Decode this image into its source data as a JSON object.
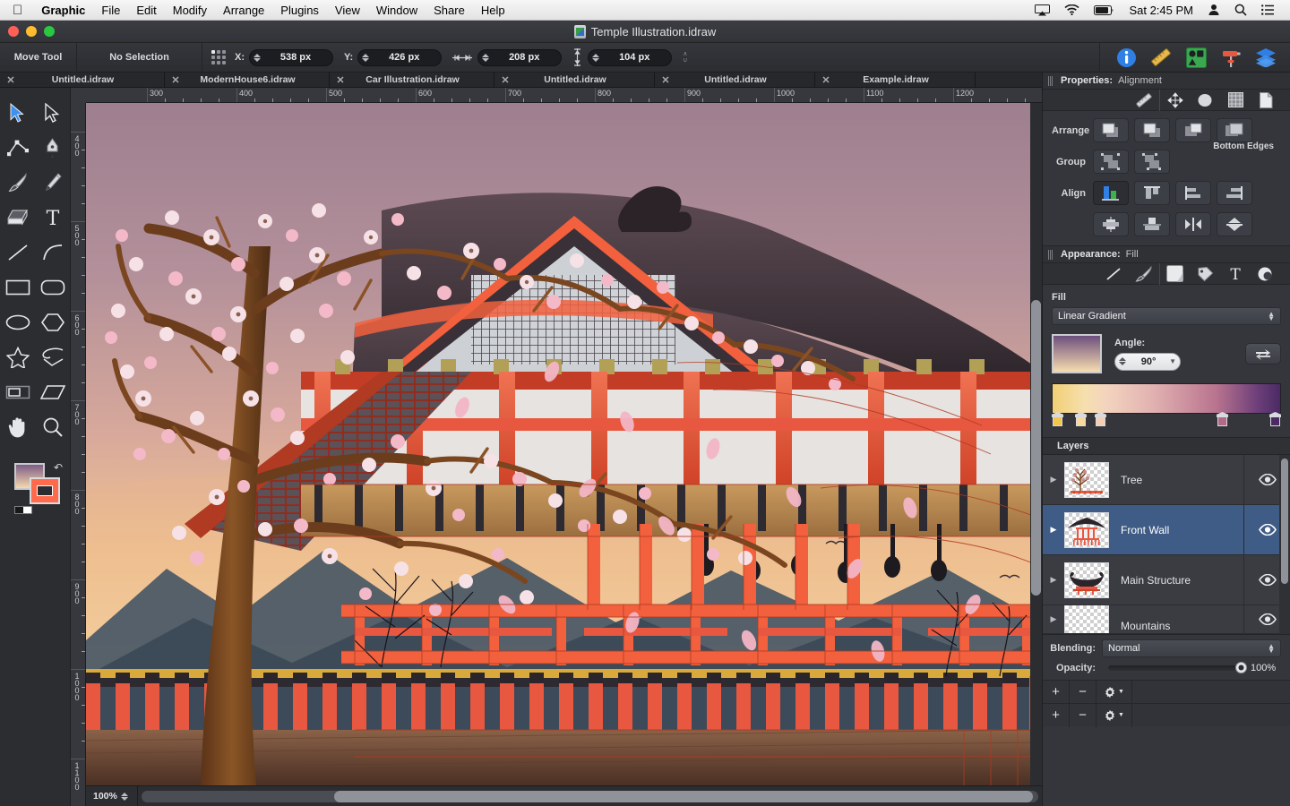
{
  "menubar": {
    "apple_icon": "apple-logo-icon",
    "items": [
      {
        "label": "Graphic",
        "bold": true
      },
      {
        "label": "File",
        "bold": false
      },
      {
        "label": "Edit",
        "bold": false
      },
      {
        "label": "Modify",
        "bold": false
      },
      {
        "label": "Arrange",
        "bold": false
      },
      {
        "label": "Plugins",
        "bold": false
      },
      {
        "label": "View",
        "bold": false
      },
      {
        "label": "Window",
        "bold": false
      },
      {
        "label": "Share",
        "bold": false
      },
      {
        "label": "Help",
        "bold": false
      }
    ],
    "status": {
      "airplay_icon": "airplay-icon",
      "wifi_icon": "wifi-icon",
      "battery_icon": "battery-icon",
      "clock": "Sat 2:45 PM",
      "user_icon": "user-account-icon",
      "search_icon": "spotlight-search-icon",
      "notifications_icon": "notification-center-icon"
    }
  },
  "window": {
    "title": "Temple Illustration.idraw",
    "close_label": "",
    "minimize_label": "",
    "zoom_label": ""
  },
  "toolbar": {
    "tool_name": "Move Tool",
    "selection_status": "No Selection",
    "anchor_icon": "anchor-grid-icon",
    "fields": [
      {
        "label": "X:",
        "value": "538 px",
        "name": "x-position-field"
      },
      {
        "label": "Y:",
        "value": "426 px",
        "name": "y-position-field"
      },
      {
        "label": "",
        "value": "208 px",
        "name": "width-field",
        "icon": "width-arrows-icon"
      },
      {
        "label": "",
        "value": "104 px",
        "name": "height-field",
        "icon": "height-arrows-icon"
      }
    ],
    "lock_icon": "link-lock-icon",
    "right_icons": [
      {
        "name": "info-icon",
        "label": "Info"
      },
      {
        "name": "ruler-icon",
        "label": "Measure"
      },
      {
        "name": "shapes-icon",
        "label": "Shapes"
      },
      {
        "name": "paint-roller-icon",
        "label": "Appearance"
      },
      {
        "name": "layers-icon",
        "label": "Layers"
      }
    ]
  },
  "tabs": {
    "close_glyph": "✕",
    "overflow_glyph": "»",
    "items": [
      {
        "label": "Untitled.idraw",
        "active": false
      },
      {
        "label": "ModernHouse6.idraw",
        "active": false
      },
      {
        "label": "Car Illustration.idraw",
        "active": false
      },
      {
        "label": "Untitled.idraw",
        "active": false
      },
      {
        "label": "Untitled.idraw",
        "active": false
      },
      {
        "label": "Example.idraw",
        "active": false
      }
    ]
  },
  "tools": [
    {
      "name": "move-tool",
      "selected": true
    },
    {
      "name": "direct-selection-tool",
      "selected": false
    },
    {
      "name": "node-tool",
      "selected": false
    },
    {
      "name": "pen-tool",
      "selected": false
    },
    {
      "name": "brush-tool",
      "selected": false
    },
    {
      "name": "pencil-tool",
      "selected": false
    },
    {
      "name": "eraser-tool",
      "selected": false
    },
    {
      "name": "text-tool",
      "selected": false
    },
    {
      "name": "line-tool",
      "selected": false
    },
    {
      "name": "arc-tool",
      "selected": false
    },
    {
      "name": "rectangle-tool",
      "selected": false
    },
    {
      "name": "rounded-rectangle-tool",
      "selected": false
    },
    {
      "name": "ellipse-tool",
      "selected": false
    },
    {
      "name": "polygon-tool",
      "selected": false
    },
    {
      "name": "star-tool",
      "selected": false
    },
    {
      "name": "spiral-tool",
      "selected": false
    },
    {
      "name": "image-tool",
      "selected": false
    },
    {
      "name": "shear-tool",
      "selected": false
    },
    {
      "name": "hand-tool",
      "selected": false
    },
    {
      "name": "zoom-tool",
      "selected": false
    }
  ],
  "rulers": {
    "horizontal_ticks": [
      "300",
      "400",
      "500",
      "600",
      "700",
      "800",
      "900",
      "1000",
      "1100",
      "1200"
    ],
    "vertical_ticks": [
      "400",
      "500",
      "600",
      "700",
      "800",
      "900",
      "1000",
      "1100"
    ],
    "unit": "px"
  },
  "canvas": {
    "zoom_level": "100%",
    "artwork_title": "Japanese temple at sunset with cherry blossom tree"
  },
  "properties": {
    "header_label": "Properties:",
    "header_value": "Alignment",
    "tabs": [
      {
        "name": "measure-tab-icon",
        "selected": false
      },
      {
        "name": "alignment-tab-icon",
        "selected": true
      },
      {
        "name": "shadow-tab-icon",
        "selected": false
      },
      {
        "name": "grid-tab-icon",
        "selected": false
      },
      {
        "name": "document-tab-icon",
        "selected": false
      }
    ],
    "arrange": {
      "label": "Arrange",
      "buttons": [
        {
          "name": "bring-to-front-button"
        },
        {
          "name": "bring-forward-button"
        },
        {
          "name": "send-backward-button"
        },
        {
          "name": "send-to-back-button"
        }
      ]
    },
    "group": {
      "label": "Group",
      "buttons": [
        {
          "name": "group-button"
        },
        {
          "name": "ungroup-button"
        }
      ]
    },
    "align": {
      "label": "Align",
      "tooltip": "Bottom Edges",
      "row1": [
        {
          "name": "align-to-selection-button",
          "selected": true
        },
        {
          "name": "align-top-edges-button",
          "selected": false
        },
        {
          "name": "align-left-edges-button",
          "selected": false
        },
        {
          "name": "align-bottom-edges-button",
          "selected": false
        }
      ],
      "row2": [
        {
          "name": "align-horizontal-centers-button",
          "selected": false
        },
        {
          "name": "align-vertical-centers-button",
          "selected": false
        },
        {
          "name": "distribute-horizontally-button",
          "selected": false
        },
        {
          "name": "distribute-vertically-button",
          "selected": false
        }
      ]
    }
  },
  "appearance": {
    "header_label": "Appearance:",
    "header_value": "Fill",
    "tabs": [
      {
        "name": "stroke-tab-icon",
        "selected": false
      },
      {
        "name": "brush-tab-icon",
        "selected": false
      },
      {
        "name": "fill-tab-icon",
        "selected": true
      },
      {
        "name": "color-tab-icon",
        "selected": false
      },
      {
        "name": "text-tab-icon",
        "selected": false
      },
      {
        "name": "shadow-effect-tab-icon",
        "selected": false
      }
    ],
    "fill": {
      "label": "Fill",
      "type": "Linear Gradient",
      "angle_label": "Angle:",
      "angle_value": "90°",
      "reverse_icon": "reverse-gradient-icon",
      "stops": [
        {
          "position": 0,
          "color": "#f0c84f"
        },
        {
          "position": 11,
          "color": "#f7d9a0"
        },
        {
          "position": 20,
          "color": "#f6ceb4"
        },
        {
          "position": 76,
          "color": "#b06a86"
        },
        {
          "position": 100,
          "color": "#4b2a64"
        }
      ],
      "preview_gradient": "linear-gradient(#6d4f7d, #f7dcb0)"
    }
  },
  "layers": {
    "header_label": "Layers",
    "items": [
      {
        "name": "Tree",
        "visible": true,
        "selected": false,
        "thumb": "tree-thumbnail"
      },
      {
        "name": "Front Wall",
        "visible": true,
        "selected": true,
        "thumb": "front-wall-thumbnail"
      },
      {
        "name": "Main Structure",
        "visible": true,
        "selected": false,
        "thumb": "main-structure-thumbnail"
      },
      {
        "name": "Mountains",
        "visible": true,
        "selected": false,
        "thumb": "mountains-thumbnail"
      }
    ],
    "blending_label": "Blending:",
    "blending_value": "Normal",
    "opacity_label": "Opacity:",
    "opacity_value": "100%",
    "opacity_percent": 100,
    "footer": {
      "add_label": "+",
      "remove_label": "−",
      "gear_label": "gear-icon"
    }
  },
  "colors": {
    "accent": "#3f5c86",
    "panel_bg": "#34363b",
    "toolbar_bg": "#2b2d31",
    "canvas_bg": "#6b5142"
  }
}
